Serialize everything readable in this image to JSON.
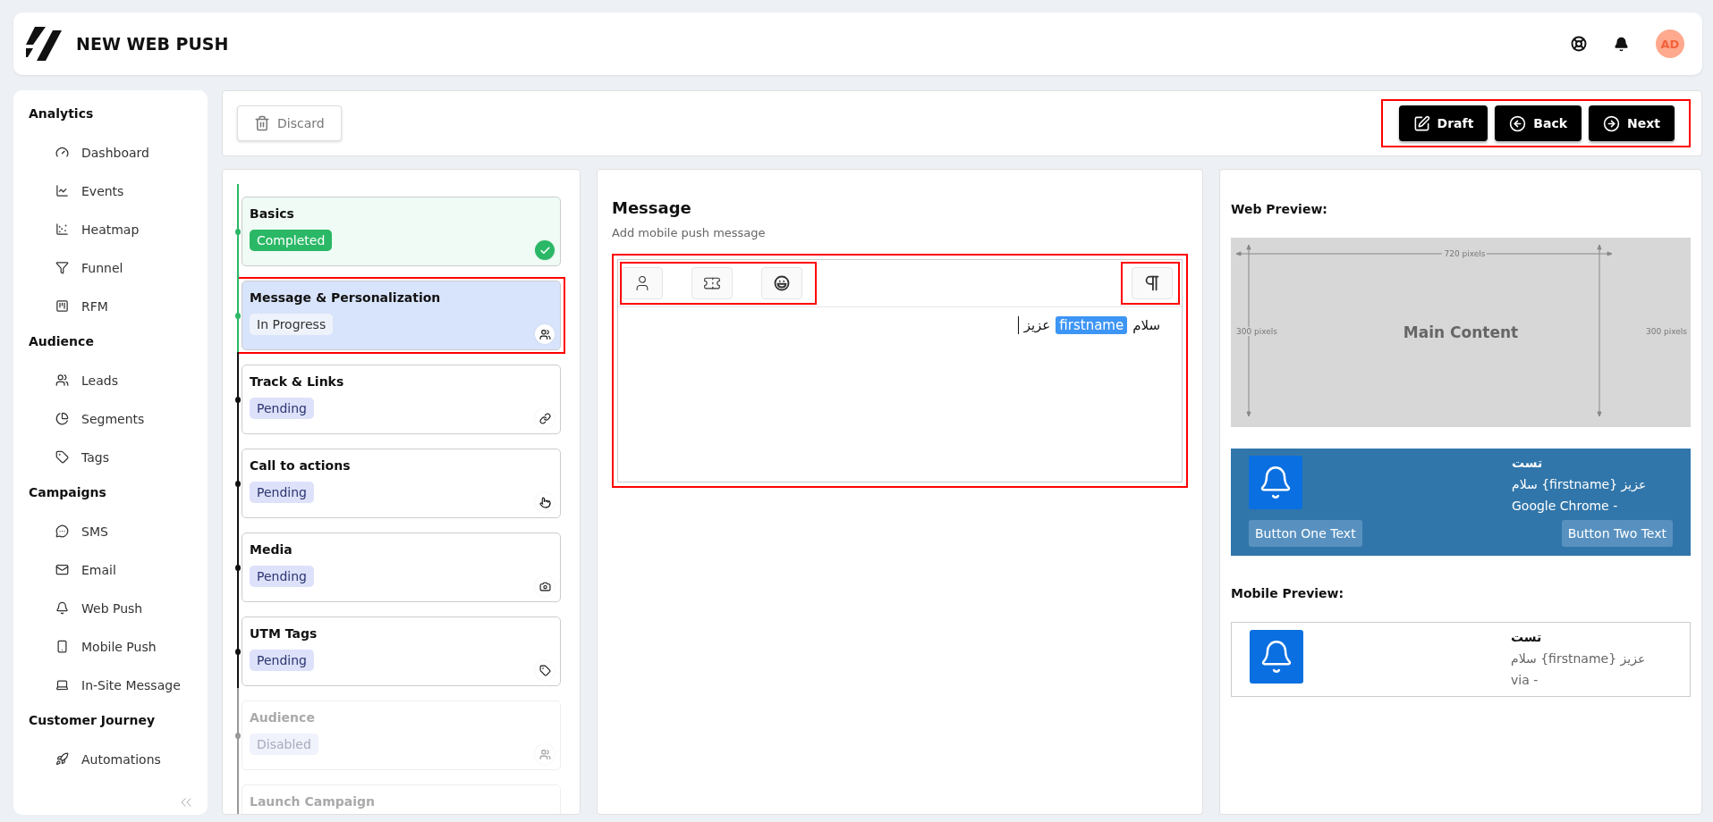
{
  "header": {
    "title": "NEW WEB PUSH",
    "avatar": "AD"
  },
  "sidebar": {
    "sections": [
      {
        "title": "Analytics",
        "items": [
          "Dashboard",
          "Events",
          "Heatmap",
          "Funnel",
          "RFM"
        ]
      },
      {
        "title": "Audience",
        "items": [
          "Leads",
          "Segments",
          "Tags"
        ]
      },
      {
        "title": "Campaigns",
        "items": [
          "SMS",
          "Email",
          "Web Push",
          "Mobile Push",
          "In-Site Message"
        ]
      },
      {
        "title": "Customer Journey",
        "items": [
          "Automations"
        ]
      }
    ]
  },
  "toolbar": {
    "discard": "Discard",
    "highlighted": true,
    "actions": [
      {
        "label": "Draft"
      },
      {
        "label": "Back"
      },
      {
        "label": "Next"
      }
    ]
  },
  "steps": [
    {
      "title": "Basics",
      "kind": "completed",
      "badge": "Completed",
      "highlighted": false
    },
    {
      "title": "Message & Personalization",
      "kind": "active",
      "badge": "In Progress",
      "highlighted": true
    },
    {
      "title": "Track & Links",
      "kind": "pending",
      "badge": "Pending",
      "highlighted": false
    },
    {
      "title": "Call to actions",
      "kind": "pending",
      "badge": "Pending",
      "highlighted": false
    },
    {
      "title": "Media",
      "kind": "pending",
      "badge": "Pending",
      "highlighted": false
    },
    {
      "title": "UTM Tags",
      "kind": "pending",
      "badge": "Pending",
      "highlighted": false
    },
    {
      "title": "Audience",
      "kind": "disabled",
      "badge": "Disabled",
      "highlighted": false
    },
    {
      "title": "Launch Campaign",
      "kind": "disabled",
      "highlighted": false
    }
  ],
  "message": {
    "title": "Message",
    "subtitle": "Add mobile push message",
    "highlighted": true,
    "tools_highlighted": true,
    "direction_highlighted": true,
    "content": [
      {
        "kind": "text",
        "text": "سلام"
      },
      {
        "kind": "tag",
        "text": "firstname"
      },
      {
        "kind": "text",
        "text": "عزیز"
      }
    ]
  },
  "web_preview": {
    "title": "Web Preview:",
    "image": {
      "width_label": "720 pixels",
      "height_labels": [
        "300 pixels",
        "300 pixels"
      ],
      "caption": "Main Content"
    },
    "notification": {
      "title": "تست",
      "body": "سلام {firstname} عزیز",
      "source": "Google Chrome -",
      "buttons": [
        "Button One Text",
        "Button Two Text"
      ]
    }
  },
  "mobile_preview": {
    "title": "Mobile Preview:",
    "notification": {
      "title": "تست",
      "body": "سلام {firstname} عزیز",
      "source": "via -"
    }
  }
}
